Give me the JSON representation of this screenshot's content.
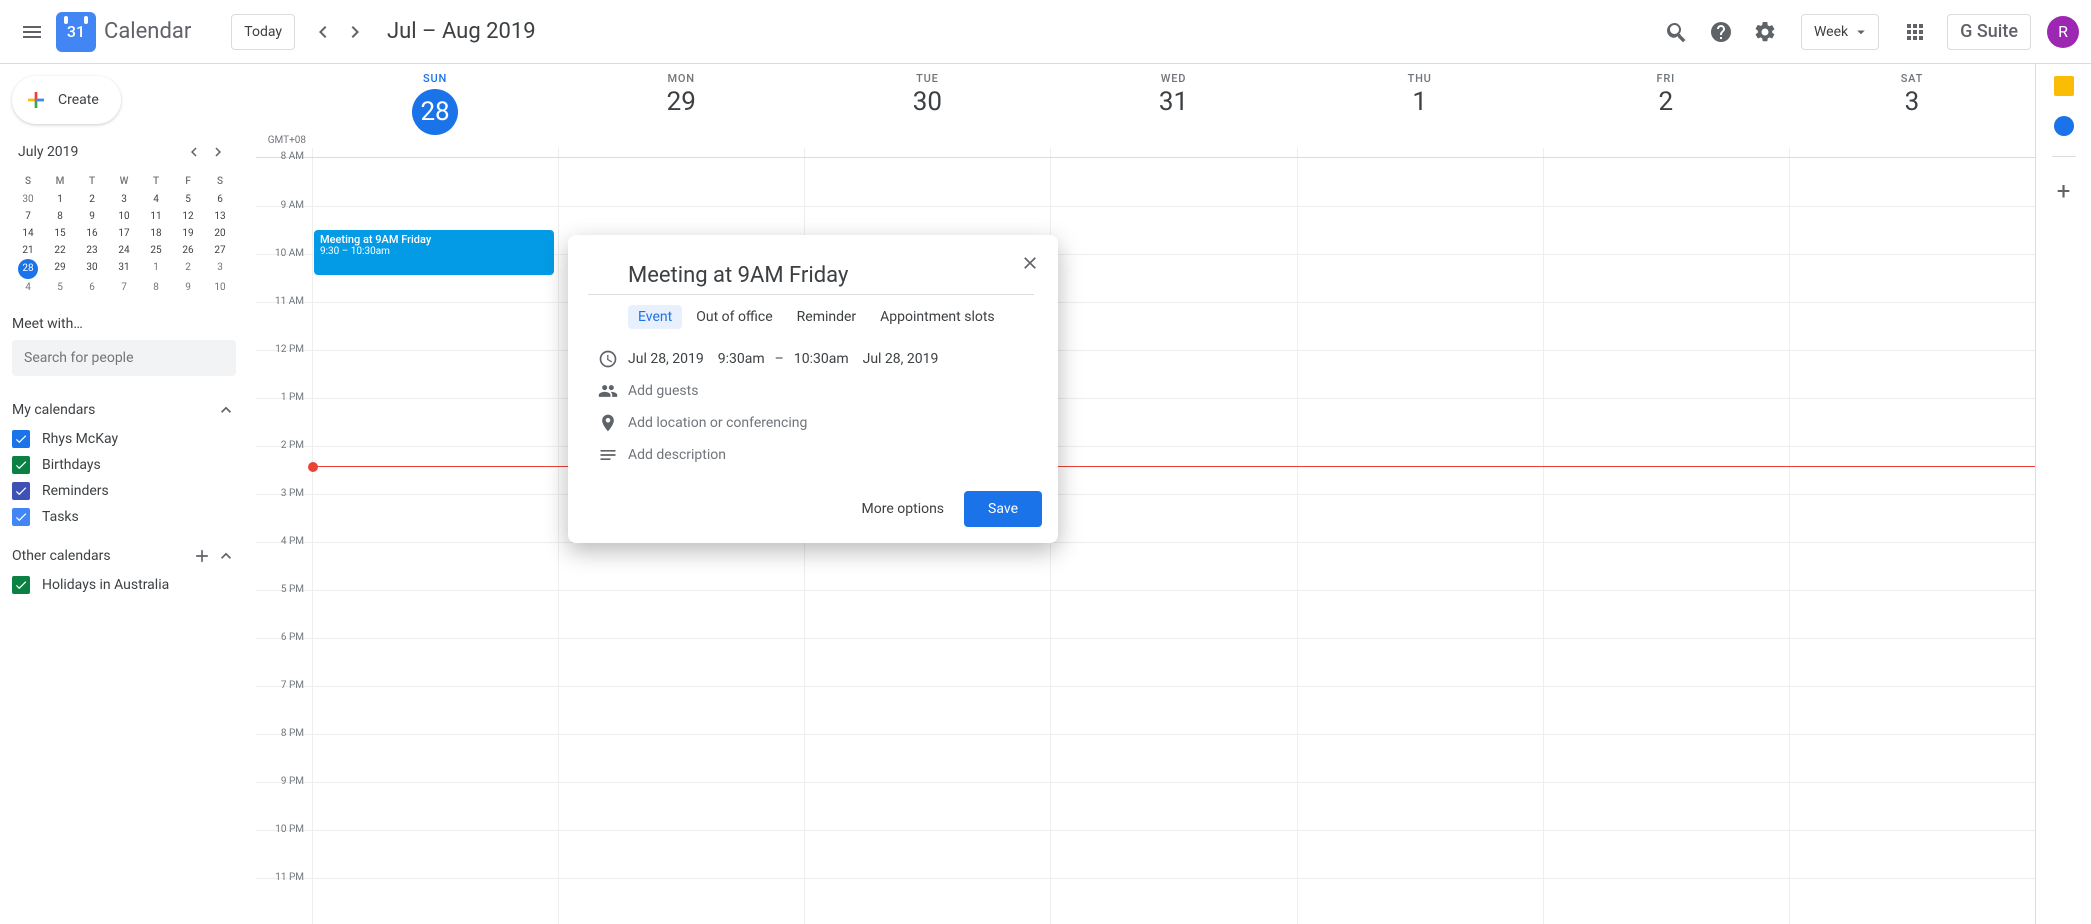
{
  "header": {
    "app_name": "Calendar",
    "logo_day": "31",
    "today_label": "Today",
    "date_range": "Jul – Aug 2019",
    "view_label": "Week",
    "suite_label": "G Suite",
    "avatar_initial": "R"
  },
  "create_label": "Create",
  "mini_cal": {
    "month": "July 2019",
    "dow": [
      "S",
      "M",
      "T",
      "W",
      "T",
      "F",
      "S"
    ],
    "days": [
      {
        "n": "30",
        "o": true
      },
      {
        "n": "1"
      },
      {
        "n": "2"
      },
      {
        "n": "3"
      },
      {
        "n": "4"
      },
      {
        "n": "5"
      },
      {
        "n": "6"
      },
      {
        "n": "7"
      },
      {
        "n": "8"
      },
      {
        "n": "9"
      },
      {
        "n": "10"
      },
      {
        "n": "11"
      },
      {
        "n": "12"
      },
      {
        "n": "13"
      },
      {
        "n": "14"
      },
      {
        "n": "15"
      },
      {
        "n": "16"
      },
      {
        "n": "17"
      },
      {
        "n": "18"
      },
      {
        "n": "19"
      },
      {
        "n": "20"
      },
      {
        "n": "21"
      },
      {
        "n": "22"
      },
      {
        "n": "23"
      },
      {
        "n": "24"
      },
      {
        "n": "25"
      },
      {
        "n": "26"
      },
      {
        "n": "27"
      },
      {
        "n": "28",
        "t": true
      },
      {
        "n": "29"
      },
      {
        "n": "30"
      },
      {
        "n": "31"
      },
      {
        "n": "1",
        "o": true
      },
      {
        "n": "2",
        "o": true
      },
      {
        "n": "3",
        "o": true
      },
      {
        "n": "4",
        "o": true
      },
      {
        "n": "5",
        "o": true
      },
      {
        "n": "6",
        "o": true
      },
      {
        "n": "7",
        "o": true
      },
      {
        "n": "8",
        "o": true
      },
      {
        "n": "9",
        "o": true
      },
      {
        "n": "10",
        "o": true
      }
    ]
  },
  "meet_with_label": "Meet with…",
  "search_people_placeholder": "Search for people",
  "my_cals_label": "My calendars",
  "my_cals": [
    {
      "label": "Rhys McKay",
      "color": "#1a73e8"
    },
    {
      "label": "Birthdays",
      "color": "#0b8043"
    },
    {
      "label": "Reminders",
      "color": "#3f51b5"
    },
    {
      "label": "Tasks",
      "color": "#4285f4"
    }
  ],
  "other_cals_label": "Other calendars",
  "other_cals": [
    {
      "label": "Holidays in Australia",
      "color": "#0b8043"
    }
  ],
  "timezone": "GMT+08",
  "week_days": [
    {
      "dow": "SUN",
      "num": "28",
      "active": true
    },
    {
      "dow": "MON",
      "num": "29"
    },
    {
      "dow": "TUE",
      "num": "30"
    },
    {
      "dow": "WED",
      "num": "31"
    },
    {
      "dow": "THU",
      "num": "1"
    },
    {
      "dow": "FRI",
      "num": "2"
    },
    {
      "dow": "SAT",
      "num": "3"
    }
  ],
  "hours": [
    "8 AM",
    "9 AM",
    "10 AM",
    "11 AM",
    "12 PM",
    "1 PM",
    "2 PM",
    "3 PM",
    "4 PM",
    "5 PM",
    "6 PM",
    "7 PM",
    "8 PM",
    "9 PM",
    "10 PM",
    "11 PM"
  ],
  "event": {
    "title": "Meeting at 9AM Friday",
    "time": "9:30 – 10:30am"
  },
  "popup": {
    "title": "Meeting at 9AM Friday",
    "tabs": [
      "Event",
      "Out of office",
      "Reminder",
      "Appointment slots"
    ],
    "date_start": "Jul 28, 2019",
    "time_start": "9:30am",
    "dash": "–",
    "time_end": "10:30am",
    "date_end": "Jul 28, 2019",
    "guests_ph": "Add guests",
    "location_ph": "Add location or conferencing",
    "desc_ph": "Add description",
    "more_label": "More options",
    "save_label": "Save"
  }
}
